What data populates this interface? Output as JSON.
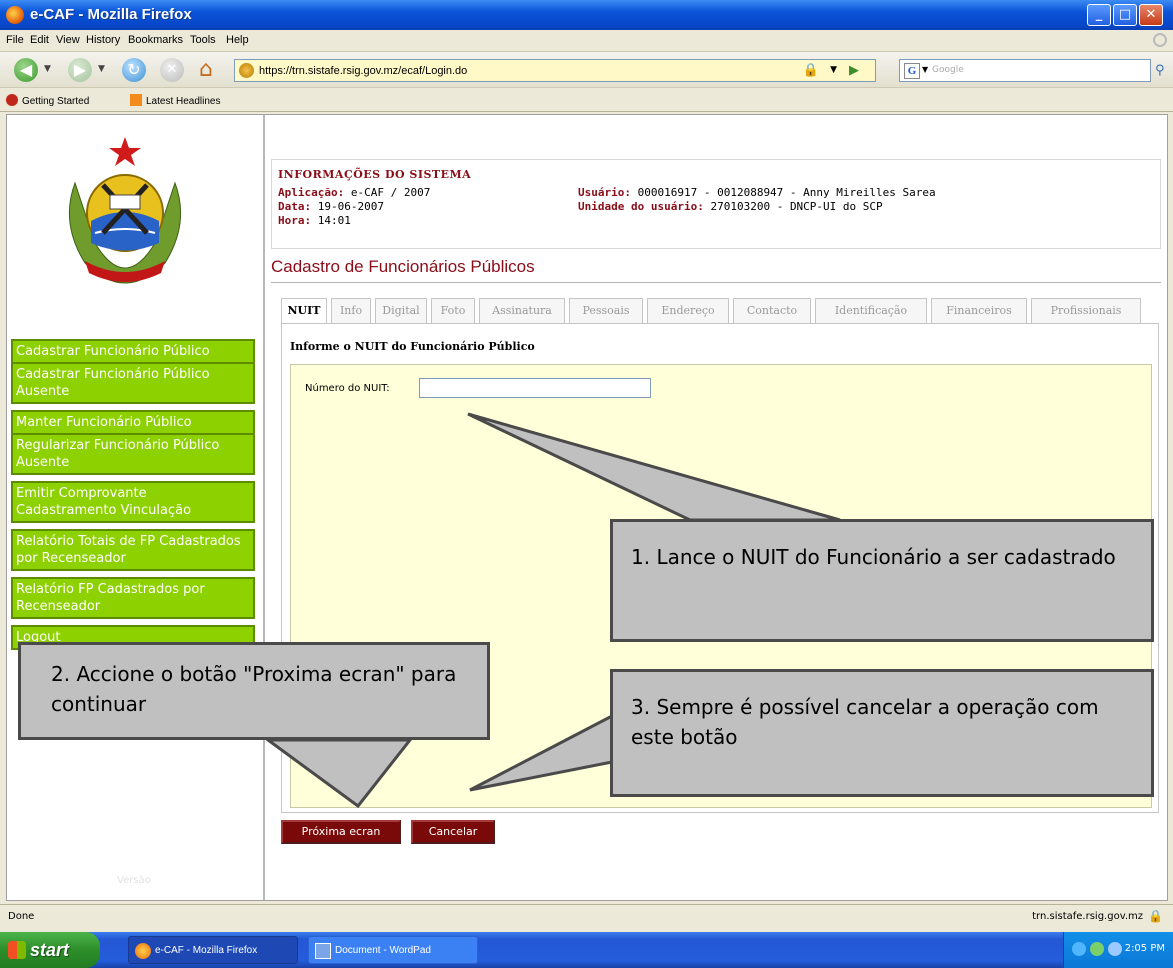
{
  "window": {
    "title": "e-CAF - Mozilla Firefox"
  },
  "menu": [
    "File",
    "Edit",
    "View",
    "History",
    "Bookmarks",
    "Tools",
    "Help"
  ],
  "navbar": {
    "url": "https://trn.sistafe.rsig.gov.mz/ecaf/Login.do",
    "search_placeholder": "Google"
  },
  "bookmarks": [
    "Getting Started",
    "Latest Headlines"
  ],
  "sidebar": {
    "links": [
      "Cadastrar Funcionário Público",
      "Cadastrar Funcionário Público Ausente",
      "Manter Funcionário Público",
      "Regularizar Funcionário Público Ausente",
      "Emitir Comprovante Cadastramento Vinculação",
      "Relatório Totais de FP Cadastrados por Recenseador",
      "Relatório FP Cadastrados por Recenseador",
      "Logout"
    ],
    "version_label": "Versão"
  },
  "sysinfo": {
    "heading": "INFORMAÇÕES DO SISTEMA",
    "aplicacao_label": "Aplicação:",
    "aplicacao_value": "e-CAF / 2007",
    "data_label": "Data:",
    "data_value": "19-06-2007",
    "hora_label": "Hora:",
    "hora_value": "14:01",
    "usuario_label": "Usuário:",
    "usuario_value": "000016917 - 0012088947 - Anny Mireilles Sarea",
    "unidade_label": "Unidade do usuário:",
    "unidade_value": "270103200 - DNCP-UI do SCP"
  },
  "page_title": "Cadastro de Funcionários Públicos",
  "tabs": [
    "NUIT",
    "Info",
    "Digital",
    "Foto",
    "Assinatura",
    "Pessoais",
    "Endereço",
    "Contacto",
    "Identificação",
    "Financeiros",
    "Profissionais"
  ],
  "active_tab": "NUIT",
  "form": {
    "heading": "Informe o NUIT do Funcionário Público",
    "nuit_label": "Número do NUIT:",
    "nuit_value": ""
  },
  "buttons": {
    "next": "Próxima ecran",
    "cancel": "Cancelar"
  },
  "callouts": {
    "one": "1. Lance o NUIT do Funcionário a ser cadastrado",
    "two": "2. Accione o botão \"Proxima ecran\" para continuar",
    "three": "3. Sempre é possível cancelar a operação com este botão"
  },
  "status": {
    "left": "Done",
    "domain": "trn.sistafe.rsig.gov.mz"
  },
  "taskbar": {
    "start": "start",
    "tasks": [
      "e-CAF - Mozilla Firefox",
      "Document - WordPad"
    ],
    "clock": "2:05 PM"
  },
  "colors": {
    "accent": "#8a0d18",
    "nav_green": "#8ed100",
    "button_maroon": "#7a0a0a",
    "form_bg": "#ffffd9"
  }
}
